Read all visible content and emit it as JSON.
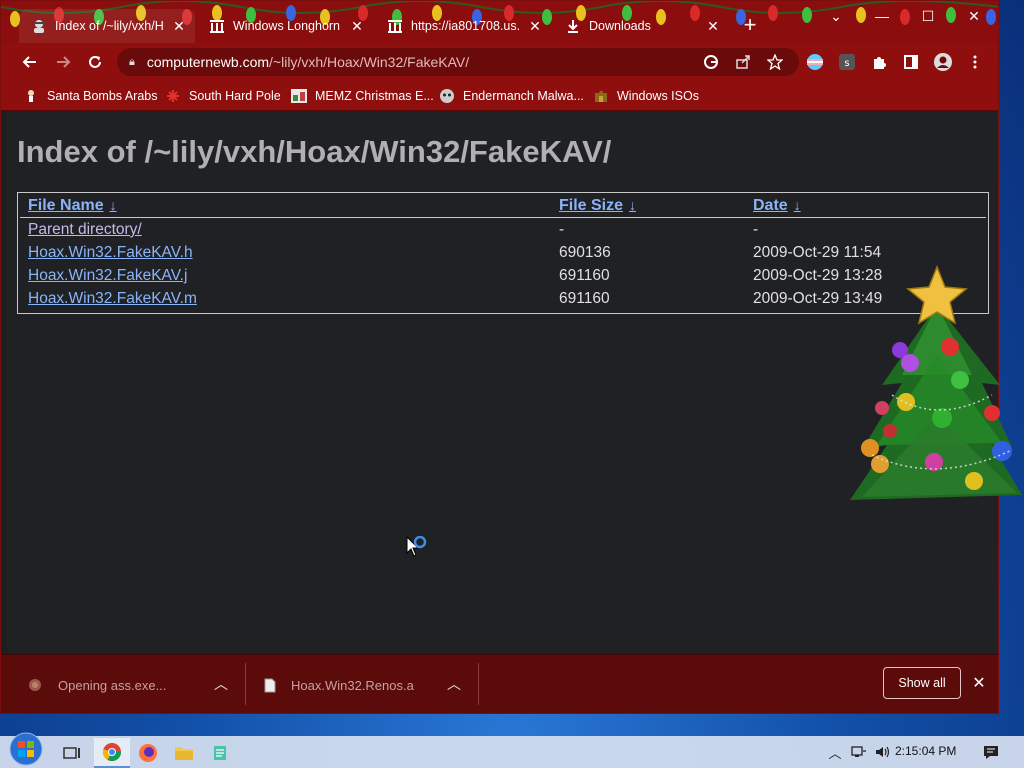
{
  "browser": {
    "tabs": [
      {
        "title": "Index of /~lily/vxh/H",
        "active": true,
        "icon": "spy-favicon"
      },
      {
        "title": "Windows Longhorn",
        "active": false,
        "icon": "archive-favicon"
      },
      {
        "title": "https://ia801708.us.",
        "active": false,
        "icon": "archive-favicon"
      },
      {
        "title": "Downloads",
        "active": false,
        "icon": "download-icon"
      }
    ],
    "url_host": "computernewb.com",
    "url_path": "/~lily/vxh/Hoax/Win32/FakeKAV/",
    "bookmarks": [
      {
        "label": "Santa Bombs Arabs"
      },
      {
        "label": "South Hard Pole"
      },
      {
        "label": "MEMZ Christmas E..."
      },
      {
        "label": "Endermanch Malwa..."
      },
      {
        "label": "Windows ISOs"
      }
    ]
  },
  "page": {
    "title": "Index of /~lily/vxh/Hoax/Win32/FakeKAV/",
    "columns": {
      "name": "File Name",
      "size": "File Size",
      "date": "Date",
      "sort_arrow": "↓"
    },
    "rows": [
      {
        "name": "Parent directory/",
        "size": "-",
        "date": "-"
      },
      {
        "name": "Hoax.Win32.FakeKAV.h",
        "size": "690136",
        "date": "2009-Oct-29 11:54"
      },
      {
        "name": "Hoax.Win32.FakeKAV.j",
        "size": "691160",
        "date": "2009-Oct-29 13:28"
      },
      {
        "name": "Hoax.Win32.FakeKAV.m",
        "size": "691160",
        "date": "2009-Oct-29 13:49"
      }
    ]
  },
  "downloads": {
    "items": [
      {
        "label": "Opening ass.exe...",
        "icon": "exe-file-icon"
      },
      {
        "label": "Hoax.Win32.Renos.a",
        "icon": "generic-file-icon"
      }
    ],
    "show_all": "Show all"
  },
  "taskbar": {
    "clock": "2:15:04 PM"
  },
  "colors": {
    "chrome_red": "#8f0f0f",
    "shelf_red": "#5c0b0b",
    "link_blue": "#8ab4f8",
    "page_bg": "#202124"
  }
}
